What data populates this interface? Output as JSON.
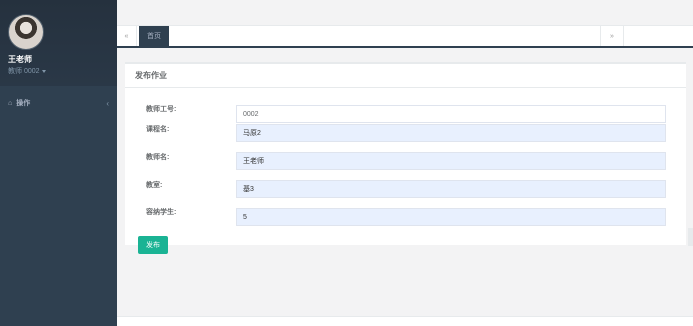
{
  "profile": {
    "name": "王老师",
    "role": "教师 0002"
  },
  "sidebar": {
    "items": [
      {
        "icon": "home-icon",
        "label": "操作",
        "chevron": "‹"
      }
    ]
  },
  "tabs": {
    "left_arrow": "«",
    "right_arrow": "»",
    "active_label": "首页"
  },
  "panel": {
    "title": "发布作业"
  },
  "form": {
    "teacher_id_label": "教师工号:",
    "teacher_id_value": "0002",
    "course_label": "课程名:",
    "course_value": "马原2",
    "teacher_name_label": "教师名:",
    "teacher_name_value": "王老师",
    "classroom_label": "教室:",
    "classroom_value": "基3",
    "capacity_label": "容纳学生:",
    "capacity_value": "5",
    "submit_label": "发布"
  },
  "colors": {
    "sidebar_bg": "#2f4050",
    "accent": "#1ab394",
    "filled_input": "#e8f0fe"
  }
}
